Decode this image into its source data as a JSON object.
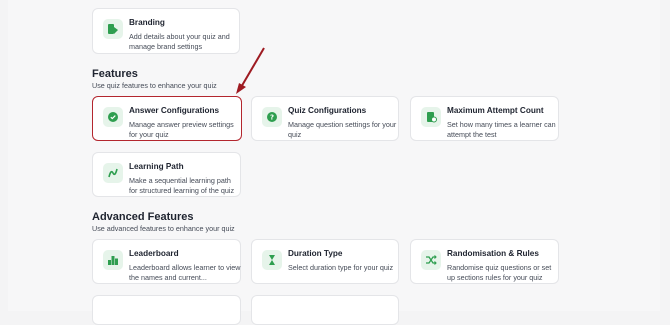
{
  "branding": {
    "title": "Branding",
    "desc": "Add details about your quiz and manage brand settings",
    "icon": "branding-icon"
  },
  "features": {
    "title": "Features",
    "subtitle": "Use quiz features to enhance your quiz",
    "items": [
      {
        "title": "Answer Configurations",
        "desc": "Manage answer preview settings for your quiz",
        "icon": "answer-chat-icon",
        "selected": true
      },
      {
        "title": "Quiz Configurations",
        "desc": "Manage question settings for your quiz",
        "icon": "quiz-chat-icon"
      },
      {
        "title": "Maximum Attempt Count",
        "desc": "Set how many times a learner can attempt the test",
        "icon": "attempt-count-icon"
      },
      {
        "title": "Learning Path",
        "desc": "Make a sequential learning path for structured learning of the quiz",
        "icon": "learning-path-icon"
      }
    ]
  },
  "advanced": {
    "title": "Advanced Features",
    "subtitle": "Use advanced features to enhance your quiz",
    "items": [
      {
        "title": "Leaderboard",
        "desc": "Leaderboard allows learner to view the names and current...",
        "icon": "leaderboard-icon"
      },
      {
        "title": "Duration Type",
        "desc": "Select duration type for your quiz",
        "icon": "hourglass-icon"
      },
      {
        "title": "Randomisation & Rules",
        "desc": "Randomise quiz questions or set up sections rules for your quiz",
        "icon": "shuffle-icon"
      }
    ]
  },
  "colors": {
    "accent_green": "#2e9e4f",
    "icon_bg": "#e6f4ea",
    "highlight_red": "#b3262e"
  }
}
